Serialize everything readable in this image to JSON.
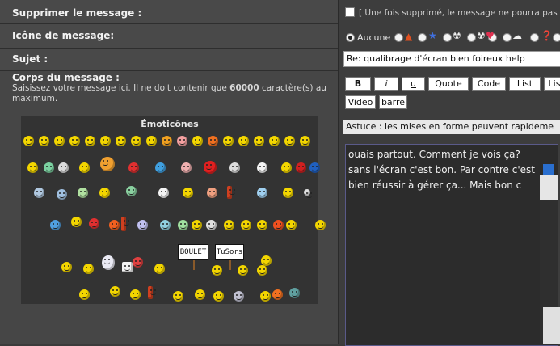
{
  "rows": {
    "delete_label": "Supprimer le message :",
    "icon_label": "Icône de message:",
    "subject_label": "Sujet :",
    "body_label": "Corps du message :",
    "body_hint_before": "Saisissez votre message ici. Il ne doit contenir que ",
    "body_hint_number": "60000",
    "body_hint_after": " caractère(s) au maximum."
  },
  "emoticons": {
    "title": "Émoticônes",
    "sign1": "BOULET",
    "sign2": "TuSors"
  },
  "delete_note": "[ Une fois supprimé, le message ne pourra pas ê",
  "icon_options": {
    "none_label": "Aucune"
  },
  "subject_value": "Re: qualibrage d'écran bien foireux help",
  "toolbar": {
    "bold": "B",
    "italic": "i",
    "underline": "u",
    "quote": "Quote",
    "code": "Code",
    "list": "List",
    "list2": "Lis",
    "video": "Video",
    "barre": "barre"
  },
  "astuce": "Astuce : les mises en forme peuvent rapideme",
  "message": {
    "line1": "ouais partout. Comment je vois ça?",
    "line2": "sans l'écran c'est bon. Par contre c'est",
    "line3": "bien réussir à gérer ça... Mais bon c"
  },
  "colors": {
    "accent": "#2a6fcf",
    "panel": "#464646",
    "smiley": "#f3d600"
  }
}
